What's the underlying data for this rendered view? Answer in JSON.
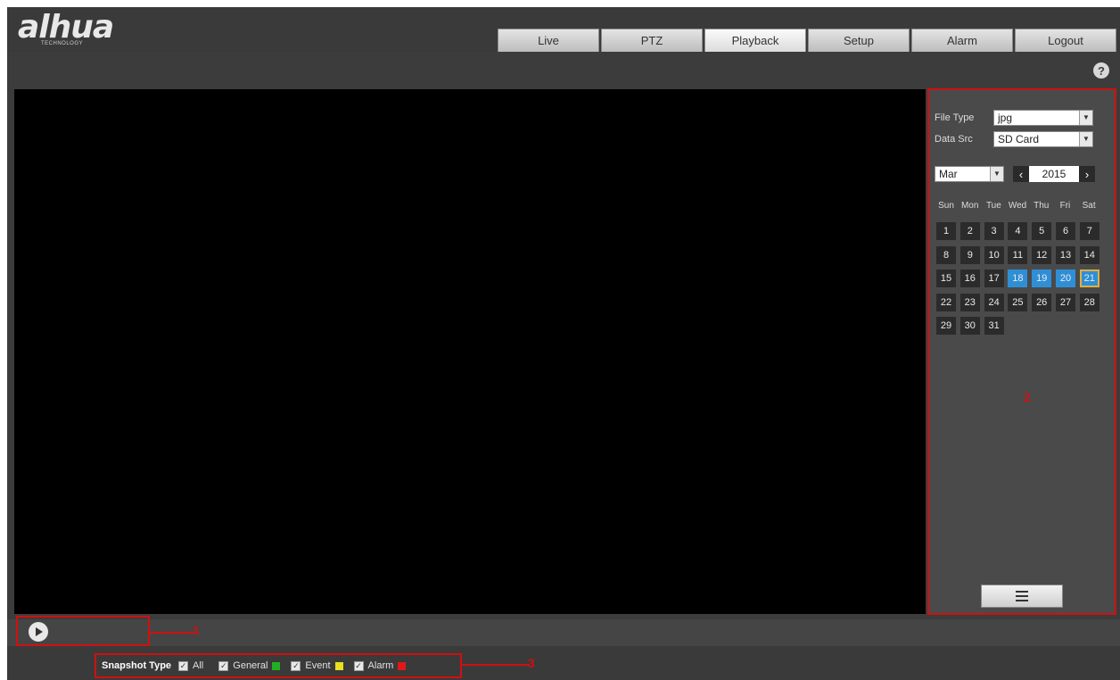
{
  "brand": {
    "logo": "alhua",
    "sub": "TECHNOLOGY"
  },
  "nav": {
    "tabs": [
      {
        "label": "Live"
      },
      {
        "label": "PTZ"
      },
      {
        "label": "Playback",
        "active": true
      },
      {
        "label": "Setup"
      },
      {
        "label": "Alarm"
      },
      {
        "label": "Logout"
      }
    ]
  },
  "help": {
    "icon": "question-icon",
    "glyph": "?"
  },
  "panel": {
    "file_type_label": "File Type",
    "file_type_value": "jpg",
    "data_src_label": "Data Src",
    "data_src_value": "SD Card",
    "month": "Mar",
    "year": "2015",
    "prev_glyph": "‹",
    "next_glyph": "›",
    "weekdays": [
      "Sun",
      "Mon",
      "Tue",
      "Wed",
      "Thu",
      "Fri",
      "Sat"
    ],
    "days": [
      "1",
      "2",
      "3",
      "4",
      "5",
      "6",
      "7",
      "8",
      "9",
      "10",
      "11",
      "12",
      "13",
      "14",
      "15",
      "16",
      "17",
      "18",
      "19",
      "20",
      "21",
      "22",
      "23",
      "24",
      "25",
      "26",
      "27",
      "28",
      "29",
      "30",
      "31"
    ],
    "highlighted_days": [
      "18",
      "19",
      "20"
    ],
    "selected_day": "21",
    "region_marker": "2"
  },
  "controls": {
    "region_marker": "1",
    "play_icon": "play-icon"
  },
  "snapshot": {
    "title": "Snapshot Type",
    "check_glyph": "✓",
    "items": [
      {
        "label": "All",
        "color": ""
      },
      {
        "label": "General",
        "color": "#22b022"
      },
      {
        "label": "Event",
        "color": "#e8e020"
      },
      {
        "label": "Alarm",
        "color": "#e01818"
      }
    ],
    "region_marker": "3"
  }
}
